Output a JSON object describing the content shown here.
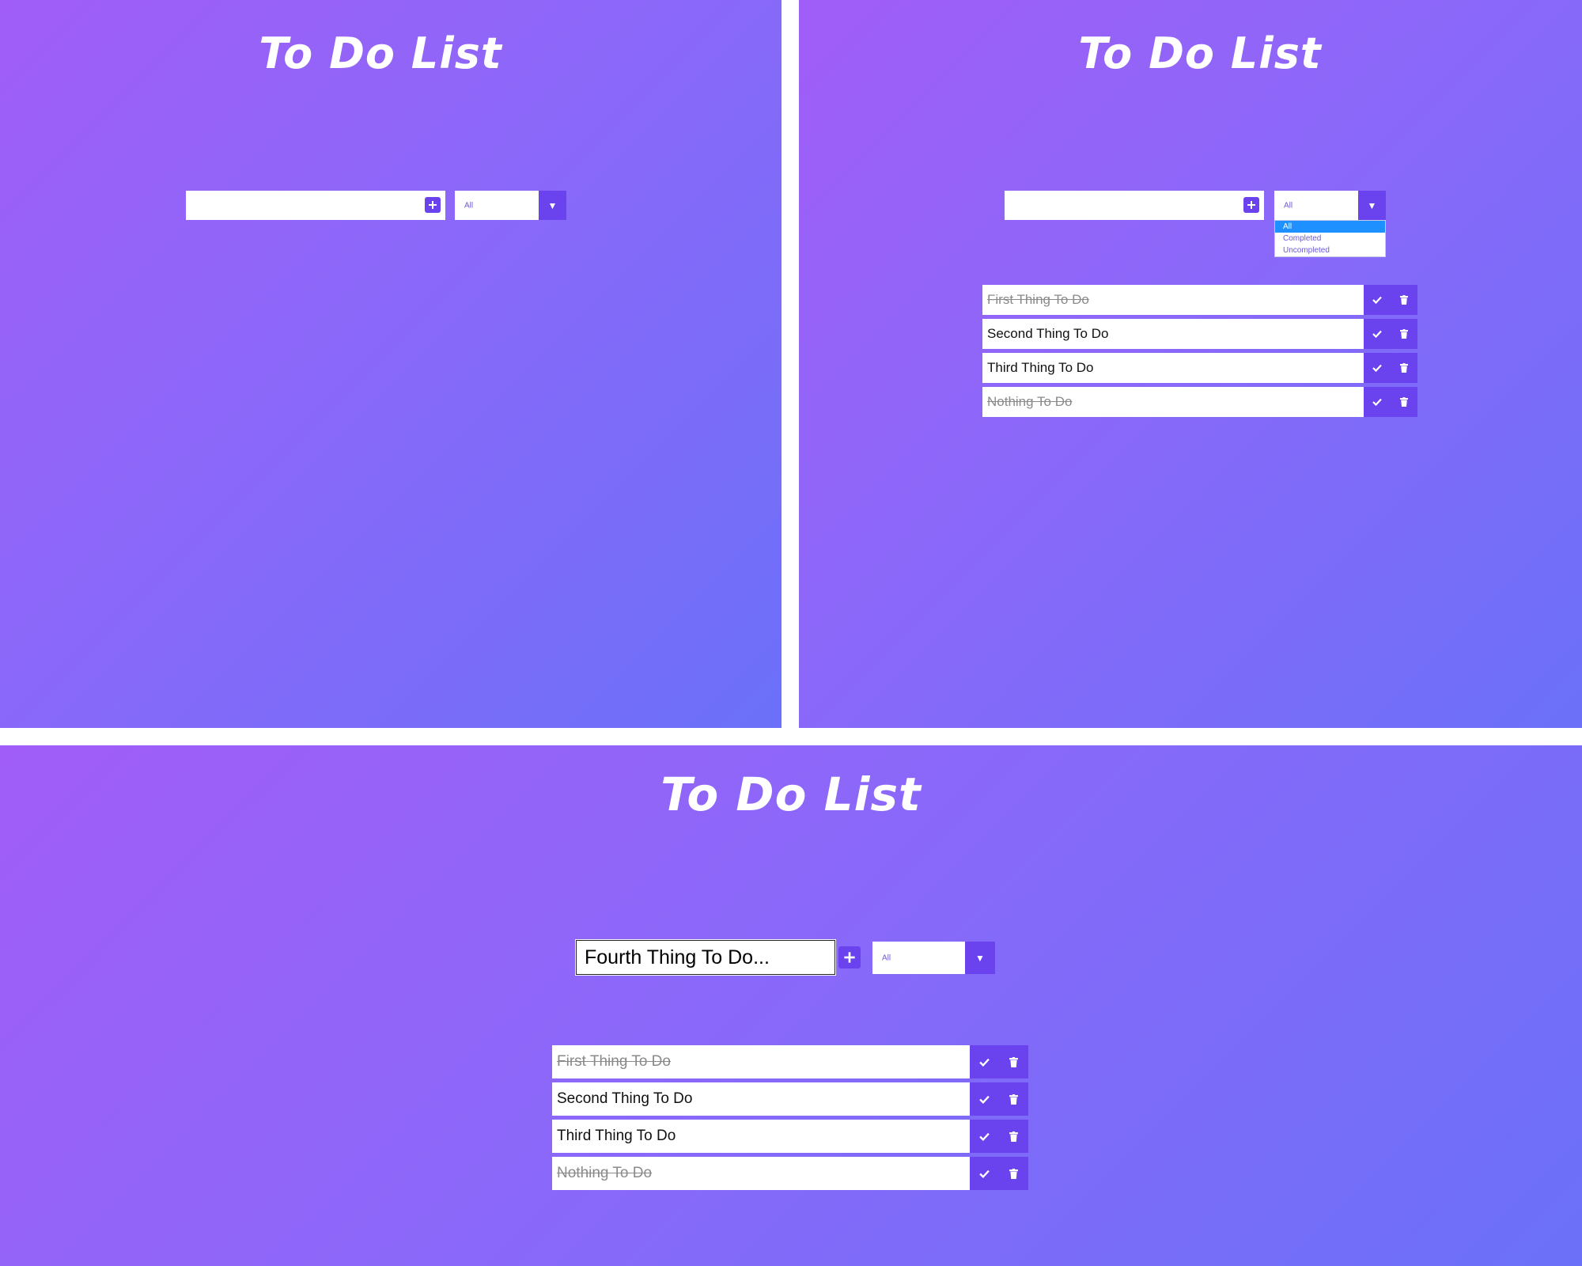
{
  "panels": [
    {
      "title": "To Do List",
      "input": {
        "value": "",
        "placeholder": ""
      },
      "filter": {
        "selected": "All"
      },
      "todos": []
    },
    {
      "title": "To Do List",
      "input": {
        "value": "",
        "placeholder": ""
      },
      "filter": {
        "selected": "All",
        "open": true,
        "options": [
          "All",
          "Completed",
          "Uncompleted"
        ]
      },
      "todos": [
        {
          "text": "First Thing To Do",
          "completed": true
        },
        {
          "text": "Second Thing To Do",
          "completed": false
        },
        {
          "text": "Third Thing To Do",
          "completed": false
        },
        {
          "text": "Nothing To Do",
          "completed": true
        }
      ]
    },
    {
      "title": "To Do List",
      "input": {
        "value": "Fourth Thing To Do...",
        "placeholder": ""
      },
      "filter": {
        "selected": "All"
      },
      "todos": [
        {
          "text": "First Thing To Do",
          "completed": true
        },
        {
          "text": "Second Thing To Do",
          "completed": false
        },
        {
          "text": "Third Thing To Do",
          "completed": false
        },
        {
          "text": "Nothing To Do",
          "completed": true
        }
      ]
    }
  ],
  "icons": {
    "add": "plus-square-icon",
    "dropdown": "triangle-down-icon",
    "complete": "check-icon",
    "delete": "trash-icon"
  },
  "colors": {
    "gradient_start": "#a05df7",
    "gradient_end": "#6b70f9",
    "accent": "#6a42ee",
    "selected_option": "#1e90ff"
  }
}
